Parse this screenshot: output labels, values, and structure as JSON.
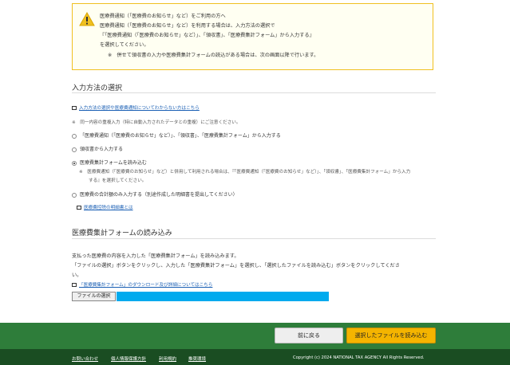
{
  "warning": {
    "line1": "医療費通知（「医療費のお知らせ」など）をご利用の方へ",
    "line2": "医療費通知（「医療費のお知らせ」など）を利用する場合は、入力方法の選択で",
    "line3": "『「医療費通知（「医療費のお知らせ」など）」、「領収書」、「医療費集計フォーム」から入力する』",
    "line4": "を選択してください。",
    "line5": "※　併せて領収書の入力や医療費集計フォームの読込がある場合は、次の画面以降で行います。",
    "icon_color": "#f0c020"
  },
  "input_method": {
    "title": "入力方法の選択",
    "help_link": "入力方法の選択や医療費通知についてわからない方はこちら",
    "duplicate_note": "※　同一内容の重複入力（特に自動入力されたデータとの重複）にご注意ください。",
    "options": [
      "「医療費通知（「医療費のお知らせ」など）」、「領収書」、「医療費集計フォーム」から入力する",
      "領収書から入力する",
      "医療費集計フォームを読み込む",
      "医療費の合計額のみ入力する（別途作成した明細書を提出してください）"
    ],
    "selected_index": 2,
    "option3_note_line1": "※　医療費通知（「医療費のお知らせ」など）と併用して利用される場合は、『「医療費通知（「医療費のお知らせ」など）」、「領収書」、「医療費集計フォーム」から入力",
    "option3_note_line2": "する』を選択してください。",
    "statement_link": "医療費控除の明細書とは"
  },
  "form_import": {
    "title": "医療費集計フォームの読み込み",
    "desc1": "支払った医療費の内容を入力した「医療費集計フォーム」を読み込みます。",
    "desc2": "「ファイルの選択」ボタンをクリックし、入力した「医療費集計フォーム」を選択し、「選択したファイルを読み込む」ボタンをクリックしてくださ",
    "desc3": "い。",
    "download_link": "「医療費集計フォーム」のダウンロード及び詳細についてはこちら",
    "file_button": "ファイルの選択"
  },
  "actions": {
    "back": "前に戻る",
    "read": "選択したファイルを読み込む"
  },
  "footer": {
    "links": [
      "お問い合わせ",
      "個人情報保護方針",
      "利用規約",
      "推奨環境"
    ],
    "copyright": "Copyright (c) 2024 NATIONAL TAX AGENCY All Rights Reserved."
  }
}
